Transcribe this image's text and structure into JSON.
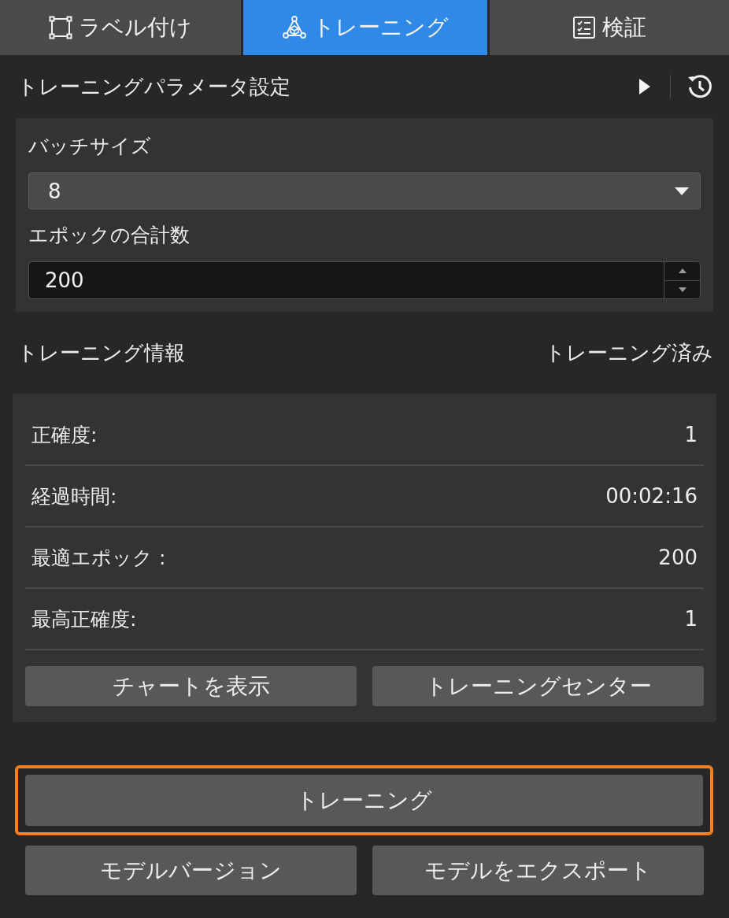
{
  "tabs": [
    {
      "label": "ラベル付け",
      "selected": false
    },
    {
      "label": "トレーニング",
      "selected": true
    },
    {
      "label": "検証",
      "selected": false
    }
  ],
  "parameters": {
    "title": "トレーニングパラメータ設定",
    "fields": [
      {
        "kind": "select",
        "label": "バッチサイズ",
        "value": "8"
      },
      {
        "kind": "number",
        "label": "エポックの合計数",
        "value": "200"
      }
    ]
  },
  "training_info": {
    "title": "トレーニング情報",
    "status": "トレーニング済み",
    "rows": [
      {
        "label": "正確度:",
        "value": "1"
      },
      {
        "label": "経過時間:",
        "value": "00:02:16"
      },
      {
        "label": "最適エポック :",
        "value": "200"
      },
      {
        "label": "最高正確度:",
        "value": "1"
      }
    ],
    "buttons": [
      "チャートを表示",
      "トレーニングセンター"
    ]
  },
  "train_button": {
    "label": "トレーニング",
    "highlighted": true
  },
  "bottom_buttons": [
    "モデルバージョン",
    "モデルをエクスポート"
  ]
}
